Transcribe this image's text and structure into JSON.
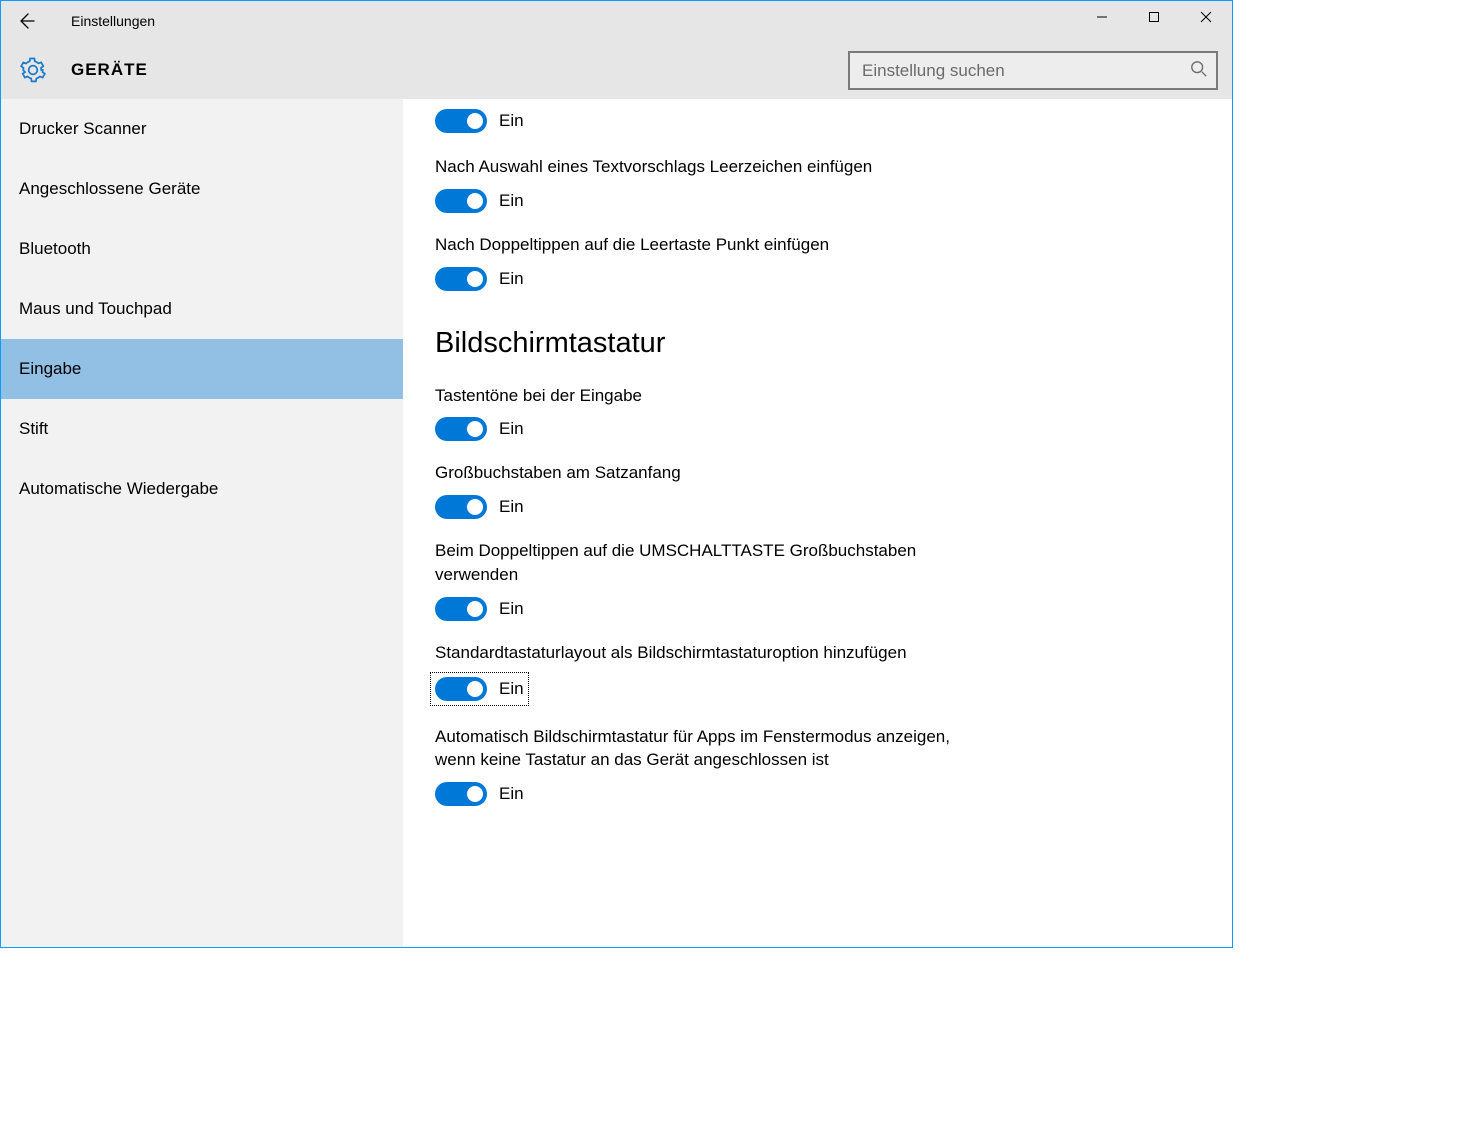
{
  "window": {
    "title": "Einstellungen",
    "page_title": "GERÄTE"
  },
  "search": {
    "placeholder": "Einstellung suchen"
  },
  "sidebar": {
    "items": [
      {
        "label": "Drucker  Scanner",
        "selected": false
      },
      {
        "label": "Angeschlossene Geräte",
        "selected": false
      },
      {
        "label": "Bluetooth",
        "selected": false
      },
      {
        "label": "Maus und Touchpad",
        "selected": false
      },
      {
        "label": "Eingabe",
        "selected": true
      },
      {
        "label": "Stift",
        "selected": false
      },
      {
        "label": "Automatische Wiedergabe",
        "selected": false
      }
    ]
  },
  "content": {
    "toggle_on_label": "Ein",
    "top_visible": [
      {
        "label": "",
        "state": "Ein"
      },
      {
        "label": "Nach Auswahl eines Textvorschlags Leerzeichen einfügen",
        "state": "Ein"
      },
      {
        "label": "Nach Doppeltippen auf die Leertaste Punkt einfügen",
        "state": "Ein"
      }
    ],
    "section_title": "Bildschirmtastatur",
    "settings": [
      {
        "label": "Tastentöne bei der Eingabe",
        "state": "Ein",
        "focused": false
      },
      {
        "label": "Großbuchstaben am Satzanfang",
        "state": "Ein",
        "focused": false
      },
      {
        "label": "Beim Doppeltippen auf die UMSCHALTTASTE Großbuchstaben verwenden",
        "state": "Ein",
        "focused": false
      },
      {
        "label": "Standardtastaturlayout als Bildschirmtastaturoption hinzufügen",
        "state": "Ein",
        "focused": true
      },
      {
        "label": "Automatisch Bildschirmtastatur für Apps im Fenstermodus anzeigen, wenn keine Tastatur an das Gerät angeschlossen ist",
        "state": "Ein",
        "focused": false
      }
    ]
  }
}
